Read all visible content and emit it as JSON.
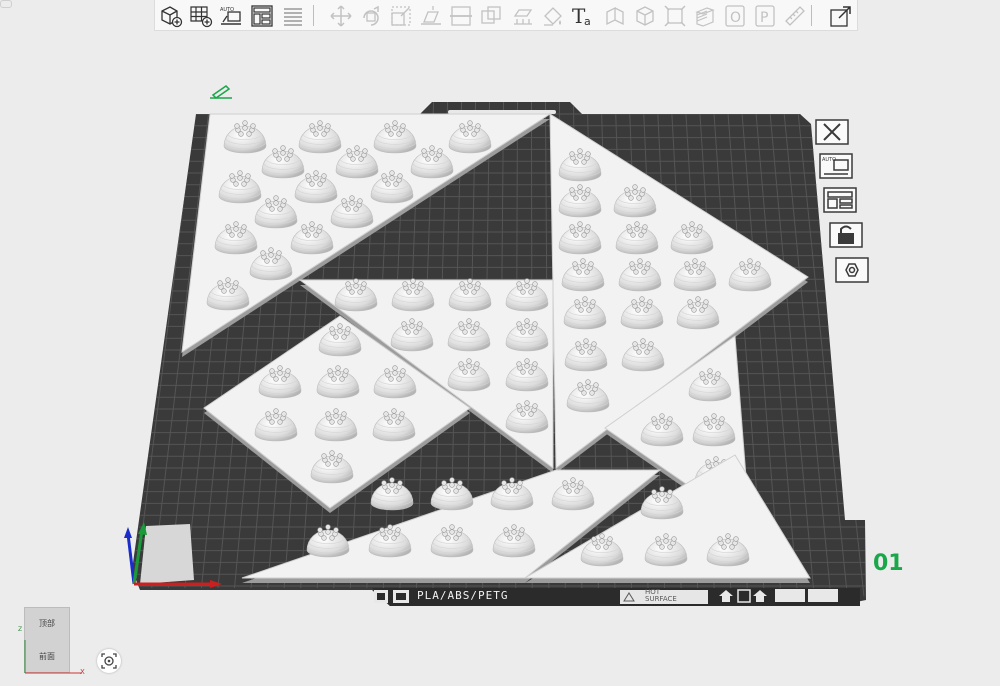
{
  "toolbar": {
    "tools": [
      {
        "icon": "add-object-icon",
        "enabled": true
      },
      {
        "icon": "add-plate-icon",
        "enabled": true
      },
      {
        "icon": "auto-arrange-icon",
        "enabled": true
      },
      {
        "icon": "plate-layout-icon",
        "enabled": true
      },
      {
        "icon": "layers-icon",
        "enabled": true
      },
      {
        "icon": "move-icon",
        "enabled": false
      },
      {
        "icon": "rotate-icon",
        "enabled": false
      },
      {
        "icon": "scale-icon",
        "enabled": false
      },
      {
        "icon": "lay-on-face-icon",
        "enabled": false
      },
      {
        "icon": "cut-icon",
        "enabled": false
      },
      {
        "icon": "boolean-icon",
        "enabled": false
      },
      {
        "icon": "support-paint-icon",
        "enabled": false
      },
      {
        "icon": "color-paint-icon",
        "enabled": false
      },
      {
        "icon": "text-tool-icon",
        "enabled": true
      },
      {
        "icon": "measure-icon",
        "enabled": false
      },
      {
        "icon": "assembly-icon",
        "enabled": false
      },
      {
        "icon": "fit-view-icon",
        "enabled": false
      },
      {
        "icon": "variable-layer-icon",
        "enabled": false
      },
      {
        "icon": "object-mode-icon",
        "enabled": false
      },
      {
        "icon": "part-mode-icon",
        "enabled": false
      },
      {
        "icon": "ruler-icon",
        "enabled": false
      },
      {
        "icon": "export-icon",
        "enabled": true
      }
    ],
    "text_tool_glyph": "Ta",
    "object_mode_glyph": "O",
    "part_mode_glyph": "P",
    "auto_glyph": "AUTO"
  },
  "plate": {
    "number": "01",
    "filament_label": "PLA/ABS/PETG",
    "hot_surface_line1": "HOT",
    "hot_surface_line2": "SURFACE"
  },
  "plate_controls": [
    {
      "icon": "close-plate-icon"
    },
    {
      "icon": "auto-arrange-plate-icon"
    },
    {
      "icon": "plate-settings-icon"
    },
    {
      "icon": "lock-plate-icon"
    },
    {
      "icon": "slice-plate-icon"
    }
  ],
  "view_cube": {
    "top_label": "顶部",
    "front_label": "前面",
    "axis_z": "Z",
    "axis_x": "X"
  },
  "colors": {
    "background": "#ececec",
    "bed": "#3a3a3a",
    "bed_grid": "#555555",
    "model": "#f2f2f2",
    "accent_green": "#1aa64a"
  },
  "objects": {
    "shape": "triangle",
    "count": 7,
    "feature": "dome-studs"
  }
}
